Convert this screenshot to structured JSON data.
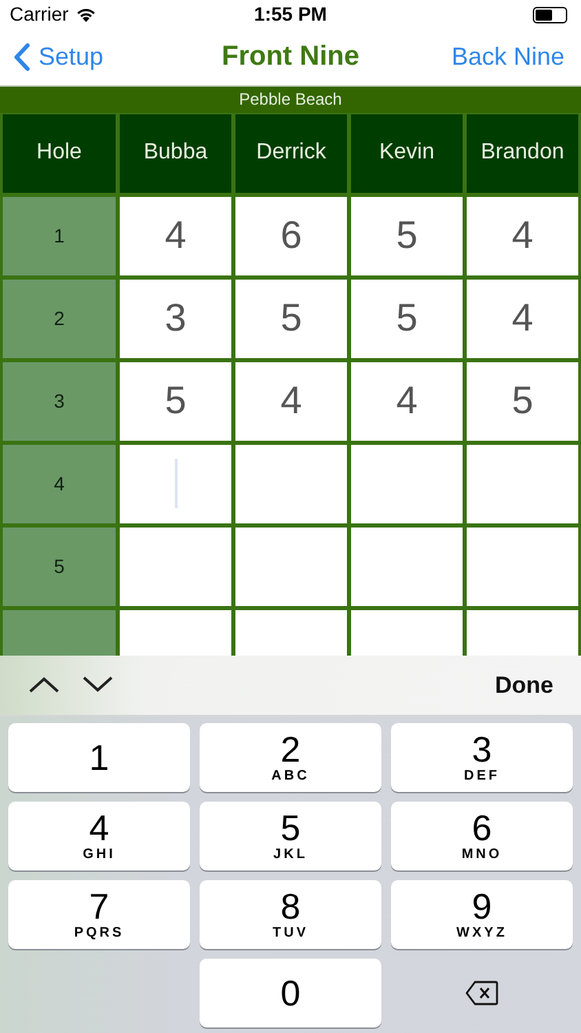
{
  "status_bar": {
    "carrier": "Carrier",
    "time": "1:55 PM"
  },
  "nav": {
    "back": "Setup",
    "title": "Front Nine",
    "right": "Back Nine"
  },
  "course": "Pebble Beach",
  "columns": [
    "Hole",
    "Bubba",
    "Derrick",
    "Kevin",
    "Brandon"
  ],
  "rows": [
    {
      "hole": "1",
      "cells": [
        {
          "value": "4",
          "focused": false
        },
        {
          "value": "6",
          "focused": false
        },
        {
          "value": "5",
          "focused": false
        },
        {
          "value": "4",
          "focused": false
        }
      ]
    },
    {
      "hole": "2",
      "cells": [
        {
          "value": "3",
          "focused": false
        },
        {
          "value": "5",
          "focused": false
        },
        {
          "value": "5",
          "focused": false
        },
        {
          "value": "4",
          "focused": false
        }
      ]
    },
    {
      "hole": "3",
      "cells": [
        {
          "value": "5",
          "focused": false
        },
        {
          "value": "4",
          "focused": false
        },
        {
          "value": "4",
          "focused": false
        },
        {
          "value": "5",
          "focused": false
        }
      ]
    },
    {
      "hole": "4",
      "cells": [
        {
          "focused": true
        },
        {
          "focused": false
        },
        {
          "focused": false
        },
        {
          "focused": false
        }
      ]
    },
    {
      "hole": "5",
      "cells": [
        {
          "focused": false
        },
        {
          "focused": false
        },
        {
          "focused": false
        },
        {
          "focused": false
        }
      ]
    },
    {
      "cells": [
        {
          "focused": false
        },
        {
          "focused": false
        },
        {
          "focused": false
        },
        {
          "focused": false
        }
      ]
    }
  ],
  "accessory": {
    "done": "Done"
  },
  "keypad": [
    {
      "kind": "digit",
      "digit": "1"
    },
    {
      "kind": "digit",
      "digit": "2",
      "letters": "ABC"
    },
    {
      "kind": "digit",
      "digit": "3",
      "letters": "DEF"
    },
    {
      "kind": "digit",
      "digit": "4",
      "letters": "GHI"
    },
    {
      "kind": "digit",
      "digit": "5",
      "letters": "JKL"
    },
    {
      "kind": "digit",
      "digit": "6",
      "letters": "MNO"
    },
    {
      "kind": "digit",
      "digit": "7",
      "letters": "PQRS"
    },
    {
      "kind": "digit",
      "digit": "8",
      "letters": "TUV"
    },
    {
      "kind": "digit",
      "digit": "9",
      "letters": "WXYZ"
    },
    {
      "kind": "blank"
    },
    {
      "kind": "digit",
      "digit": "0"
    },
    {
      "kind": "delete"
    }
  ]
}
